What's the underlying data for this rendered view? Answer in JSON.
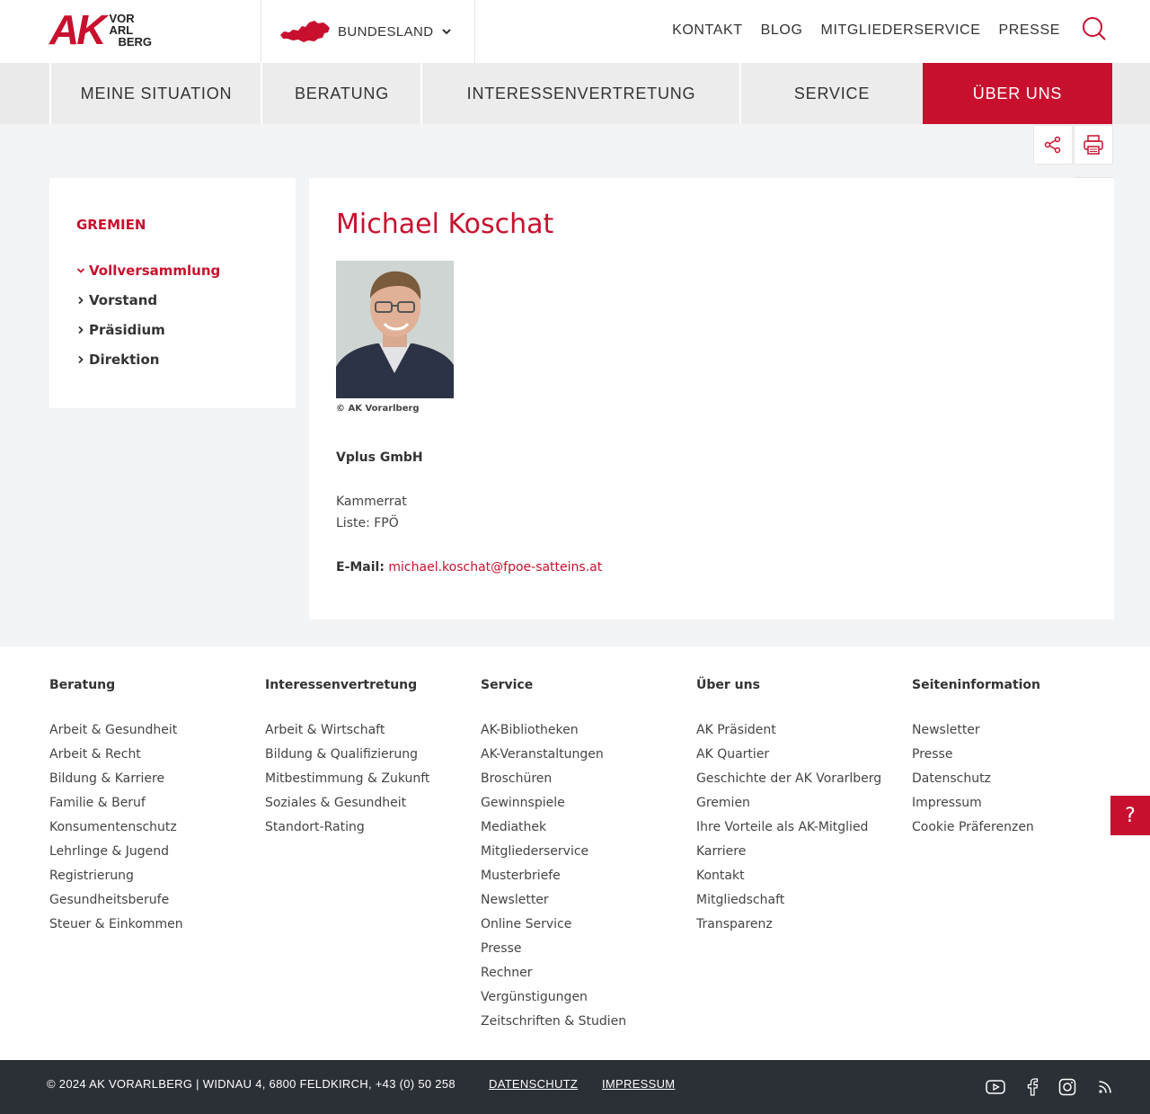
{
  "header": {
    "logo_letters": "AK",
    "logo_lines": [
      "VOR",
      "ARL",
      "BERG"
    ],
    "bundesland_label": "BUNDESLAND",
    "top_links": [
      "KONTAKT",
      "BLOG",
      "MITGLIEDERSERVICE",
      "PRESSE"
    ]
  },
  "nav": {
    "items": [
      "MEINE SITUATION",
      "BERATUNG",
      "INTERESSENVERTRETUNG",
      "SERVICE",
      "ÜBER UNS"
    ],
    "active": "ÜBER UNS"
  },
  "sidebar": {
    "title": "GREMIEN",
    "items": [
      "Vollversammlung",
      "Vorstand",
      "Präsidium",
      "Direktion"
    ],
    "active": "Vollversammlung"
  },
  "profile": {
    "name": "Michael Koschat",
    "photo_caption": "© AK Vorarlberg",
    "company": "Vplus GmbH",
    "role": "Kammerrat",
    "list": "Liste: FPÖ",
    "email_label": "E-Mail:",
    "email": "michael.koschat@fpoe-satteins.at"
  },
  "footer": {
    "columns": [
      {
        "title": "Beratung",
        "links": [
          "Arbeit & Gesundheit",
          "Arbeit & Recht",
          "Bildung & Karriere",
          "Familie & Beruf",
          "Konsumentenschutz",
          "Lehrlinge & Jugend",
          "Registrierung",
          "Gesundheitsberufe",
          "Steuer & Einkommen"
        ]
      },
      {
        "title": "Interessenvertretung",
        "links": [
          "Arbeit & Wirtschaft",
          "Bildung & Qualifizierung",
          "Mitbestimmung & Zukunft",
          "Soziales & Gesundheit",
          "Standort-Rating"
        ]
      },
      {
        "title": "Service",
        "links": [
          "AK-Bibliotheken",
          "AK-Veranstaltungen",
          "Broschüren",
          "Gewinnspiele",
          "Mediathek",
          "Mitgliederservice",
          "Musterbriefe",
          "Newsletter",
          "Online Service",
          "Presse",
          "Rechner",
          "Vergünstigungen",
          "Zeitschriften & Studien"
        ]
      },
      {
        "title": "Über uns",
        "links": [
          "AK Präsident",
          "AK Quartier",
          "Geschichte der AK Vorarlberg",
          "Gremien",
          "Ihre Vorteile als AK-Mitglied",
          "Karriere",
          "Kontakt",
          "Mitgliedschaft",
          "Transparenz"
        ]
      },
      {
        "title": "Seiteninformation",
        "links": [
          "Newsletter",
          "Presse",
          "Datenschutz",
          "Impressum",
          "Cookie Präferenzen"
        ]
      }
    ],
    "help_label": "?",
    "copyright": "© 2024 AK VORARLBERG | WIDNAU 4, 6800 FELDKIRCH, +43 (0) 50 258",
    "bottom_links": [
      "DATENSCHUTZ",
      "IMPRESSUM"
    ],
    "social_icons": [
      "youtube-icon",
      "facebook-icon",
      "instagram-icon",
      "rss-icon"
    ]
  },
  "colors": {
    "brand_red": "#c8102e",
    "footer_dark": "#2b2f36",
    "page_bg": "#f2f3f4"
  }
}
